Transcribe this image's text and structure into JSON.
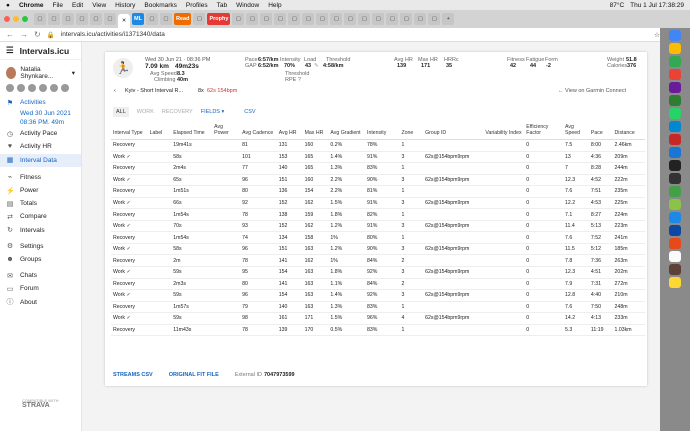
{
  "menubar": {
    "items": [
      "Chrome",
      "File",
      "Edit",
      "View",
      "History",
      "Bookmarks",
      "Profiles",
      "Tab",
      "Window",
      "Help"
    ],
    "right": [
      "87°C",
      "Thu 1 Jul 17:38:29"
    ]
  },
  "tabs": {
    "ml": "ML",
    "read": "Read",
    "prophy": "Prophy"
  },
  "address": {
    "url": "intervals.icu/activities/i1371340/data"
  },
  "sidebar": {
    "app_title": "Intervals.icu",
    "user_name": "Natalia Shynkare...",
    "items": [
      {
        "label": "Activities",
        "icon": "run-icon",
        "style": "blue"
      },
      {
        "label": "Activity Pace",
        "icon": "stopwatch-icon",
        "style": ""
      },
      {
        "label": "Activity HR",
        "icon": "heart-icon",
        "style": ""
      },
      {
        "label": "Interval Data",
        "icon": "grid-icon",
        "style": "blue active"
      },
      {
        "label": "Fitness",
        "icon": "chart-icon",
        "style": ""
      },
      {
        "label": "Power",
        "icon": "power-icon",
        "style": ""
      },
      {
        "label": "Totals",
        "icon": "totals-icon",
        "style": ""
      },
      {
        "label": "Compare",
        "icon": "compare-icon",
        "style": ""
      },
      {
        "label": "Intervals",
        "icon": "intervals-icon",
        "style": ""
      },
      {
        "label": "Settings",
        "icon": "gear-icon",
        "style": ""
      },
      {
        "label": "Groups",
        "icon": "groups-icon",
        "style": ""
      },
      {
        "label": "Chats",
        "icon": "chat-icon",
        "style": ""
      },
      {
        "label": "Forum",
        "icon": "forum-icon",
        "style": ""
      },
      {
        "label": "About",
        "icon": "info-icon",
        "style": ""
      }
    ],
    "date1": "Wed 30 Jun 2021",
    "date2": "08:36 PM. 49m",
    "strava_small": "COMPATIBLE WITH",
    "strava": "STRAVA"
  },
  "activity": {
    "date": "Wed 30 Jun 21 · 08:36 PM",
    "distance": "7.09 km",
    "time": "49m23s",
    "avg_speed_label": "Avg Speed",
    "avg_speed": "8.3",
    "climbing_label": "Climbing",
    "climbing": "40m",
    "pace_label": "Pace",
    "pace": "6:57/km",
    "gap_label": "GAP",
    "gap": "6:52/km",
    "intensity_label": "Intensity",
    "intensity": "70%",
    "load_label": "Load",
    "load": "43",
    "threshold_label": "Threshold",
    "threshold": "4:58/km",
    "threshold2_label": "Threshold",
    "rpe": "RPE ?",
    "avghr_label": "Avg HR",
    "avghr": "139",
    "maxhr_label": "Max HR",
    "maxhr": "171",
    "hrrc_label": "HRRc",
    "hrrc": "35",
    "fitness_label": "Fitness",
    "fitness": "42",
    "fatigue_label": "Fatigue",
    "fatigue": "44",
    "form_label": "Form",
    "form": "-2",
    "weight_label": "Weight",
    "weight": "51.8",
    "calories_label": "Calories",
    "calories": "376",
    "name": "Kyiv - Short Interval R...",
    "name_suffix": "8x",
    "name_highlight": "62s 154bpm",
    "view_garmin": "← View on Garmin Connect"
  },
  "toolbar": {
    "all": "ALL",
    "work": "WORK",
    "recovery": "RECOVERY",
    "fields": "FIELDS ▾",
    "csv": "CSV"
  },
  "table": {
    "headers": [
      "Interval Type",
      "Label",
      "Elapsed Time",
      "Avg Power",
      "Avg Cadence",
      "Avg HR",
      "Max HR",
      "Avg Gradient",
      "Intensity",
      "Zone",
      "Group ID",
      "Variability Index",
      "Efficiency Factor",
      "Avg Speed",
      "Pace",
      "Distance"
    ],
    "rows": [
      [
        "Recovery",
        "",
        "19m41s",
        "",
        "81",
        "131",
        "160",
        "0.2%",
        "78%",
        "1",
        "",
        "",
        "0",
        "7.5",
        "8:00",
        "2.46km"
      ],
      [
        "Work ✓",
        "",
        "58s",
        "",
        "101",
        "153",
        "165",
        "1.4%",
        "91%",
        "3",
        "62s@154bpm9rpm",
        "",
        "0",
        "13",
        "4:36",
        "209m"
      ],
      [
        "Recovery",
        "",
        "2m4s",
        "",
        "77",
        "140",
        "165",
        "1.3%",
        "83%",
        "1",
        "",
        "",
        "0",
        "7",
        "8:28",
        "244m"
      ],
      [
        "Work ✓",
        "",
        "65s",
        "",
        "96",
        "151",
        "160",
        "2.2%",
        "90%",
        "3",
        "62s@154bpm9rpm",
        "",
        "0",
        "12.3",
        "4:52",
        "222m"
      ],
      [
        "Recovery",
        "",
        "1m51s",
        "",
        "80",
        "136",
        "154",
        "2.2%",
        "81%",
        "1",
        "",
        "",
        "0",
        "7.6",
        "7:51",
        "235m"
      ],
      [
        "Work ✓",
        "",
        "66s",
        "",
        "92",
        "152",
        "162",
        "1.5%",
        "91%",
        "3",
        "62s@154bpm9rpm",
        "",
        "0",
        "12.2",
        "4:53",
        "225m"
      ],
      [
        "Recovery",
        "",
        "1m54s",
        "",
        "78",
        "138",
        "159",
        "1.8%",
        "82%",
        "1",
        "",
        "",
        "0",
        "7.1",
        "8:27",
        "224m"
      ],
      [
        "Work ✓",
        "",
        "70s",
        "",
        "93",
        "152",
        "162",
        "1.2%",
        "91%",
        "3",
        "62s@154bpm9rpm",
        "",
        "0",
        "11.4",
        "5:13",
        "223m"
      ],
      [
        "Recovery",
        "",
        "1m54s",
        "",
        "74",
        "134",
        "158",
        "1%",
        "80%",
        "1",
        "",
        "",
        "0",
        "7.6",
        "7:52",
        "241m"
      ],
      [
        "Work ✓",
        "",
        "58s",
        "",
        "96",
        "151",
        "163",
        "1.2%",
        "90%",
        "3",
        "62s@154bpm9rpm",
        "",
        "0",
        "11.5",
        "5:12",
        "185m"
      ],
      [
        "Recovery",
        "",
        "2m",
        "",
        "78",
        "141",
        "162",
        "1%",
        "84%",
        "2",
        "",
        "",
        "0",
        "7.8",
        "7:36",
        "263m"
      ],
      [
        "Work ✓",
        "",
        "59s",
        "",
        "95",
        "154",
        "163",
        "1.8%",
        "92%",
        "3",
        "62s@154bpm9rpm",
        "",
        "0",
        "12.3",
        "4:51",
        "202m"
      ],
      [
        "Recovery",
        "",
        "2m3s",
        "",
        "80",
        "141",
        "163",
        "1.1%",
        "84%",
        "2",
        "",
        "",
        "0",
        "7.9",
        "7:31",
        "272m"
      ],
      [
        "Work ✓",
        "",
        "59s",
        "",
        "96",
        "154",
        "163",
        "1.4%",
        "92%",
        "3",
        "62s@154bpm9rpm",
        "",
        "0",
        "12.8",
        "4:40",
        "210m"
      ],
      [
        "Recovery",
        "",
        "1m57s",
        "",
        "79",
        "140",
        "163",
        "1.3%",
        "83%",
        "1",
        "",
        "",
        "0",
        "7.6",
        "7:50",
        "248m"
      ],
      [
        "Work ✓",
        "",
        "59s",
        "",
        "98",
        "161",
        "171",
        "1.5%",
        "96%",
        "4",
        "62s@154bpm9rpm",
        "",
        "0",
        "14.2",
        "4:13",
        "233m"
      ],
      [
        "Recovery",
        "",
        "11m43s",
        "",
        "78",
        "139",
        "170",
        "0.5%",
        "83%",
        "1",
        "",
        "",
        "0",
        "5.3",
        "11:19",
        "1.03km"
      ]
    ]
  },
  "footer": {
    "streams_csv": "STREAMS CSV",
    "original_fit": "ORIGINAL FIT FILE",
    "external_label": "External ID",
    "external_id": "7047973599"
  },
  "colors": {
    "accent": "#1565c0",
    "active_bg": "#e6eef9",
    "highlight": "#d32f2f"
  }
}
